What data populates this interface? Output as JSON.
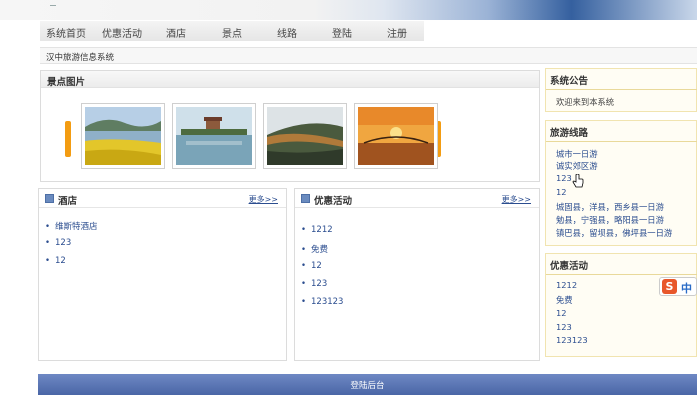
{
  "nav": {
    "items": [
      "系统首页",
      "优惠活动",
      "酒店",
      "景点",
      "线路",
      "登陆",
      "注册"
    ]
  },
  "breadcrumb": "汉中旅游信息系统",
  "scenic": {
    "title": "景点图片"
  },
  "hotel": {
    "title": "酒店",
    "more": "更多>>",
    "items": [
      "维斯特酒店",
      "123",
      "12"
    ]
  },
  "promo": {
    "title": "优惠活动",
    "more": "更多>>",
    "items": [
      "1212",
      "免费",
      "12",
      "123",
      "123123"
    ]
  },
  "sidebar": {
    "notice": {
      "title": "系统公告",
      "text": "欢迎来到本系统"
    },
    "routes": {
      "title": "旅游线路",
      "items": [
        "城市一日游",
        "诚实郊区游",
        "123",
        "12",
        "城固县，洋县，西乡县一日游",
        "勉县，宁强县，略阳县一日游",
        "镇巴县，留坝县，佛坪县一日游"
      ]
    },
    "promo": {
      "title": "优惠活动",
      "items": [
        "1212",
        "免费",
        "12",
        "123",
        "123123"
      ]
    }
  },
  "footer": {
    "label": "登陆后台"
  },
  "ime": {
    "logo": "S",
    "mode": "中"
  }
}
